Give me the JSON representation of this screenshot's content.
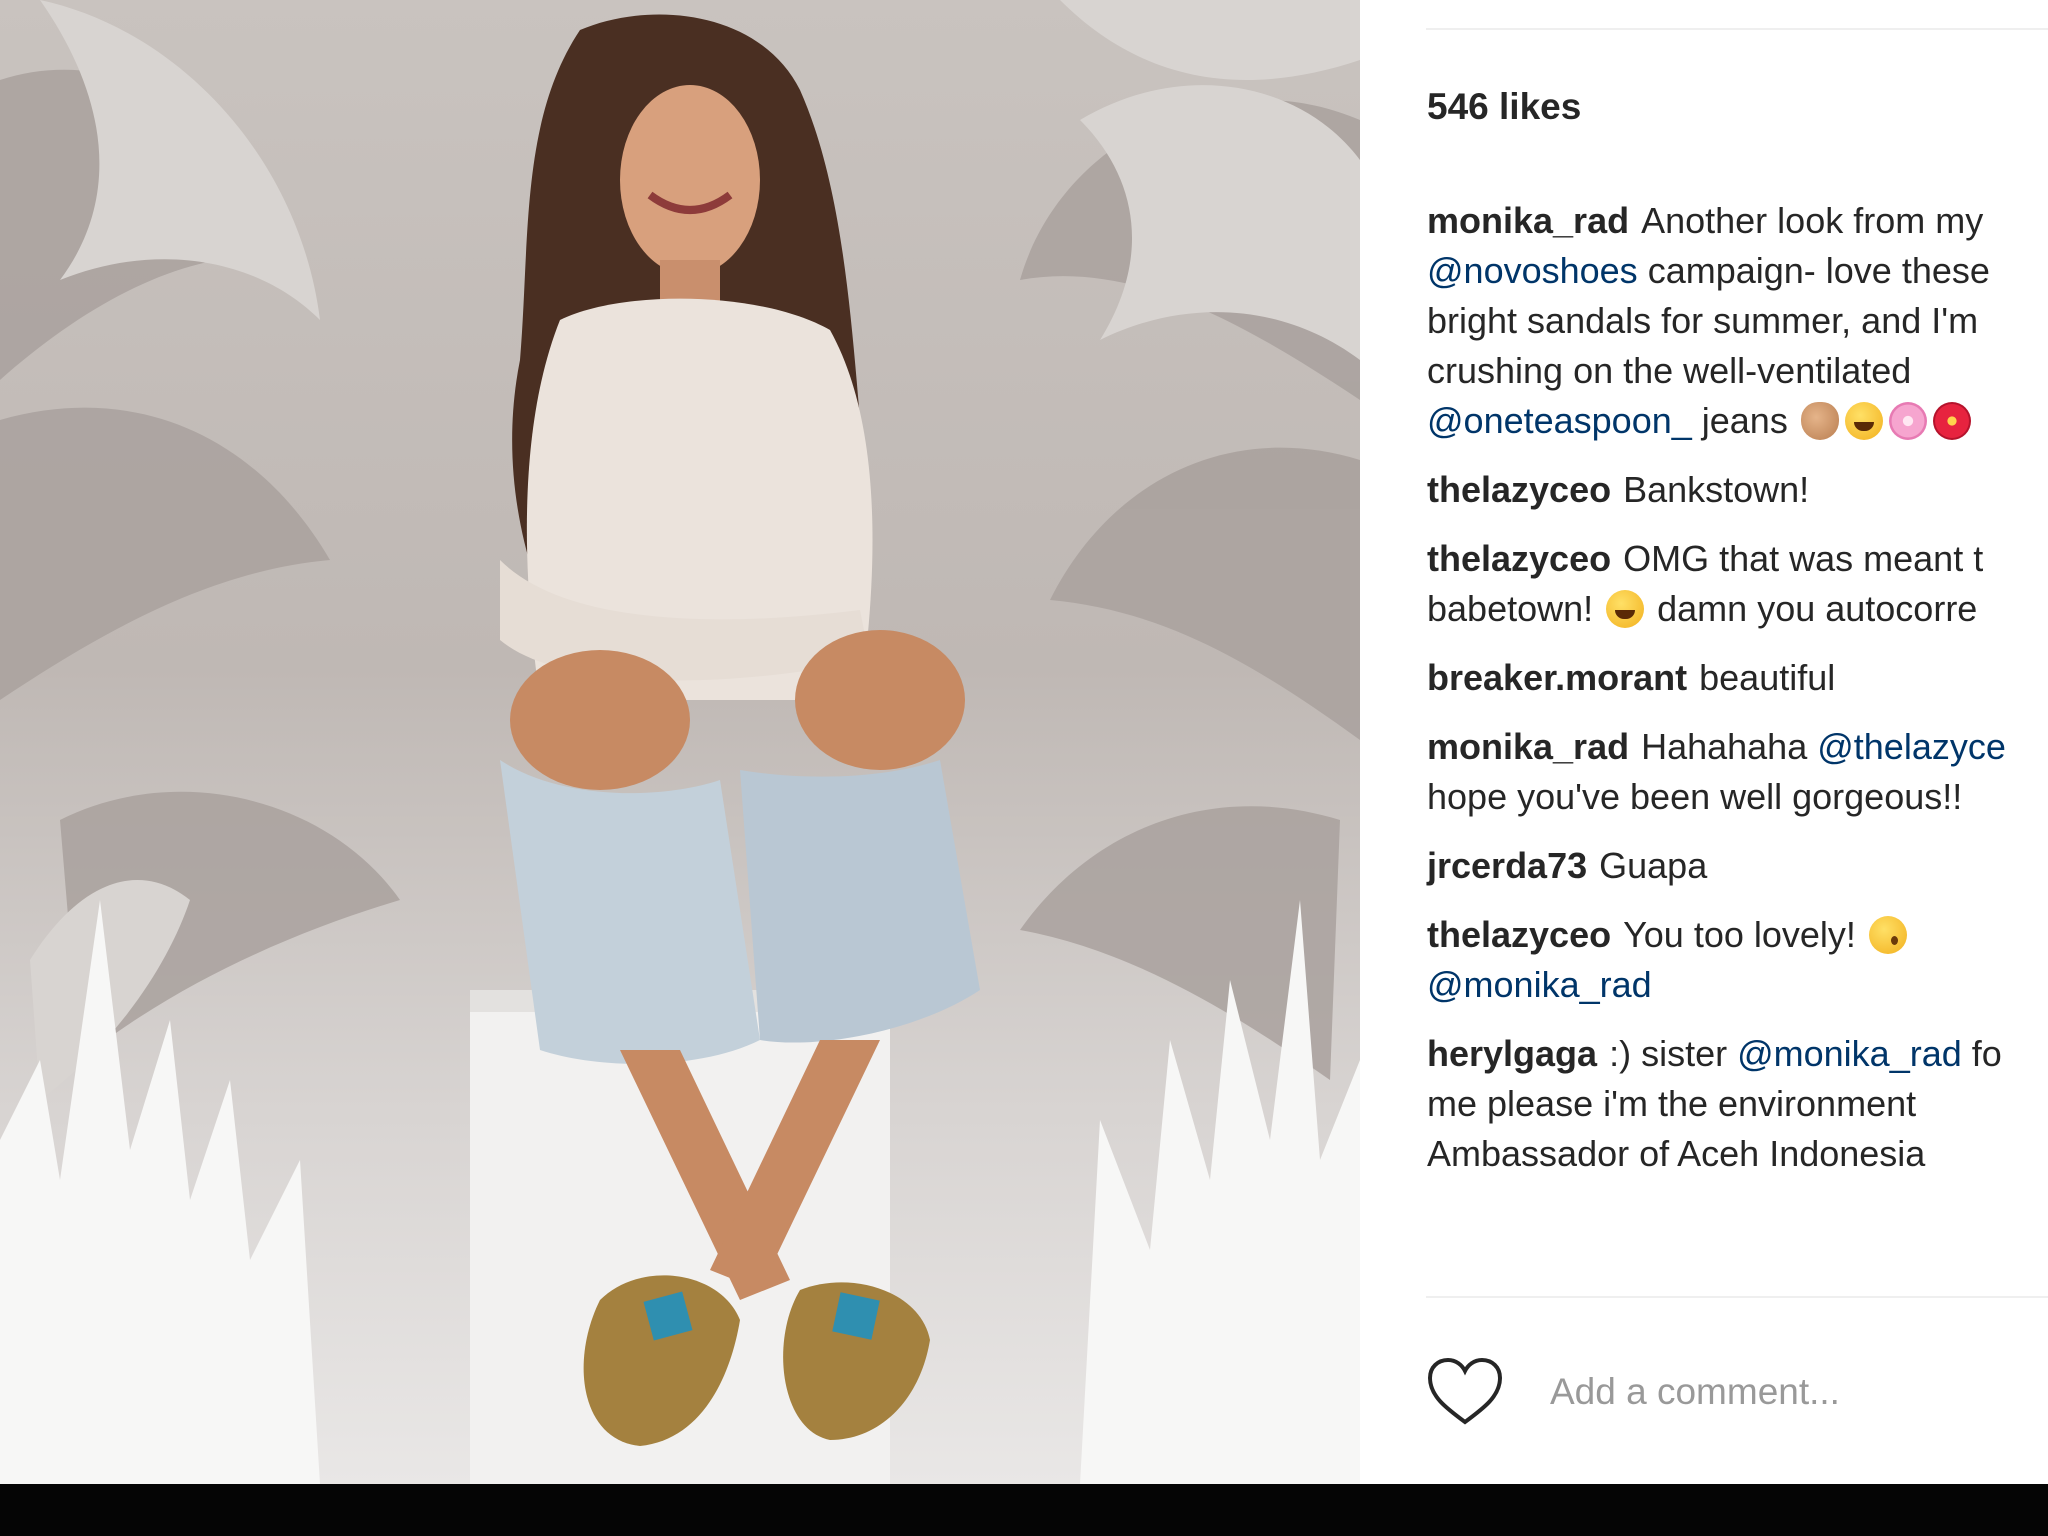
{
  "post": {
    "likes": "546 likes",
    "comments": [
      {
        "lines": [
          [
            {
              "type": "user",
              "text": "monika_rad"
            },
            {
              "type": "text",
              "text": "Another look from my"
            }
          ],
          [
            {
              "type": "mention",
              "text": "@novoshoes"
            },
            {
              "type": "text",
              "text": " campaign- love these"
            }
          ],
          [
            {
              "type": "text",
              "text": "bright sandals for summer, and I'm"
            }
          ],
          [
            {
              "type": "text",
              "text": "crushing on the well-ventilated"
            }
          ],
          [
            {
              "type": "mention",
              "text": "@oneteaspoon_"
            },
            {
              "type": "text",
              "text": " jeans "
            },
            {
              "type": "emoji",
              "name": "ok-hand-emoji"
            },
            {
              "type": "emoji",
              "name": "laughing-emoji"
            },
            {
              "type": "emoji",
              "name": "cherry-blossom-emoji"
            },
            {
              "type": "emoji",
              "name": "hibiscus-emoji"
            }
          ]
        ]
      },
      {
        "lines": [
          [
            {
              "type": "user",
              "text": "thelazyceo"
            },
            {
              "type": "text",
              "text": "Bankstown!"
            }
          ]
        ]
      },
      {
        "lines": [
          [
            {
              "type": "user",
              "text": "thelazyceo"
            },
            {
              "type": "text",
              "text": "OMG that was meant t"
            }
          ],
          [
            {
              "type": "text",
              "text": "babetown! "
            },
            {
              "type": "emoji",
              "name": "tears-of-joy-emoji"
            },
            {
              "type": "text",
              "text": " damn you autocorre"
            }
          ]
        ]
      },
      {
        "lines": [
          [
            {
              "type": "user",
              "text": "breaker.morant"
            },
            {
              "type": "text",
              "text": "beautiful"
            }
          ]
        ]
      },
      {
        "lines": [
          [
            {
              "type": "user",
              "text": "monika_rad"
            },
            {
              "type": "text",
              "text": "Hahahaha "
            },
            {
              "type": "mention",
              "text": "@thelazyce"
            }
          ],
          [
            {
              "type": "text",
              "text": "hope you've been well gorgeous!!"
            }
          ]
        ]
      },
      {
        "lines": [
          [
            {
              "type": "user",
              "text": "jrcerda73"
            },
            {
              "type": "text",
              "text": "Guapa"
            }
          ]
        ]
      },
      {
        "lines": [
          [
            {
              "type": "user",
              "text": "thelazyceo"
            },
            {
              "type": "text",
              "text": "You too lovely! "
            },
            {
              "type": "emoji",
              "name": "kiss-emoji"
            }
          ],
          [
            {
              "type": "mention",
              "text": "@monika_rad"
            }
          ]
        ]
      },
      {
        "lines": [
          [
            {
              "type": "user",
              "text": "herylgaga"
            },
            {
              "type": "text",
              "text": ":) sister "
            },
            {
              "type": "mention",
              "text": "@monika_rad"
            },
            {
              "type": "text",
              "text": " fo"
            }
          ],
          [
            {
              "type": "text",
              "text": "me please i'm the environment"
            }
          ],
          [
            {
              "type": "text",
              "text": "Ambassador of Aceh Indonesia"
            }
          ]
        ]
      }
    ]
  },
  "actions": {
    "like_icon": "heart-icon",
    "comment_placeholder": "Add a comment..."
  },
  "colors": {
    "text": "#262626",
    "mention": "#003569",
    "placeholder": "#999999",
    "divider": "#efefef"
  }
}
